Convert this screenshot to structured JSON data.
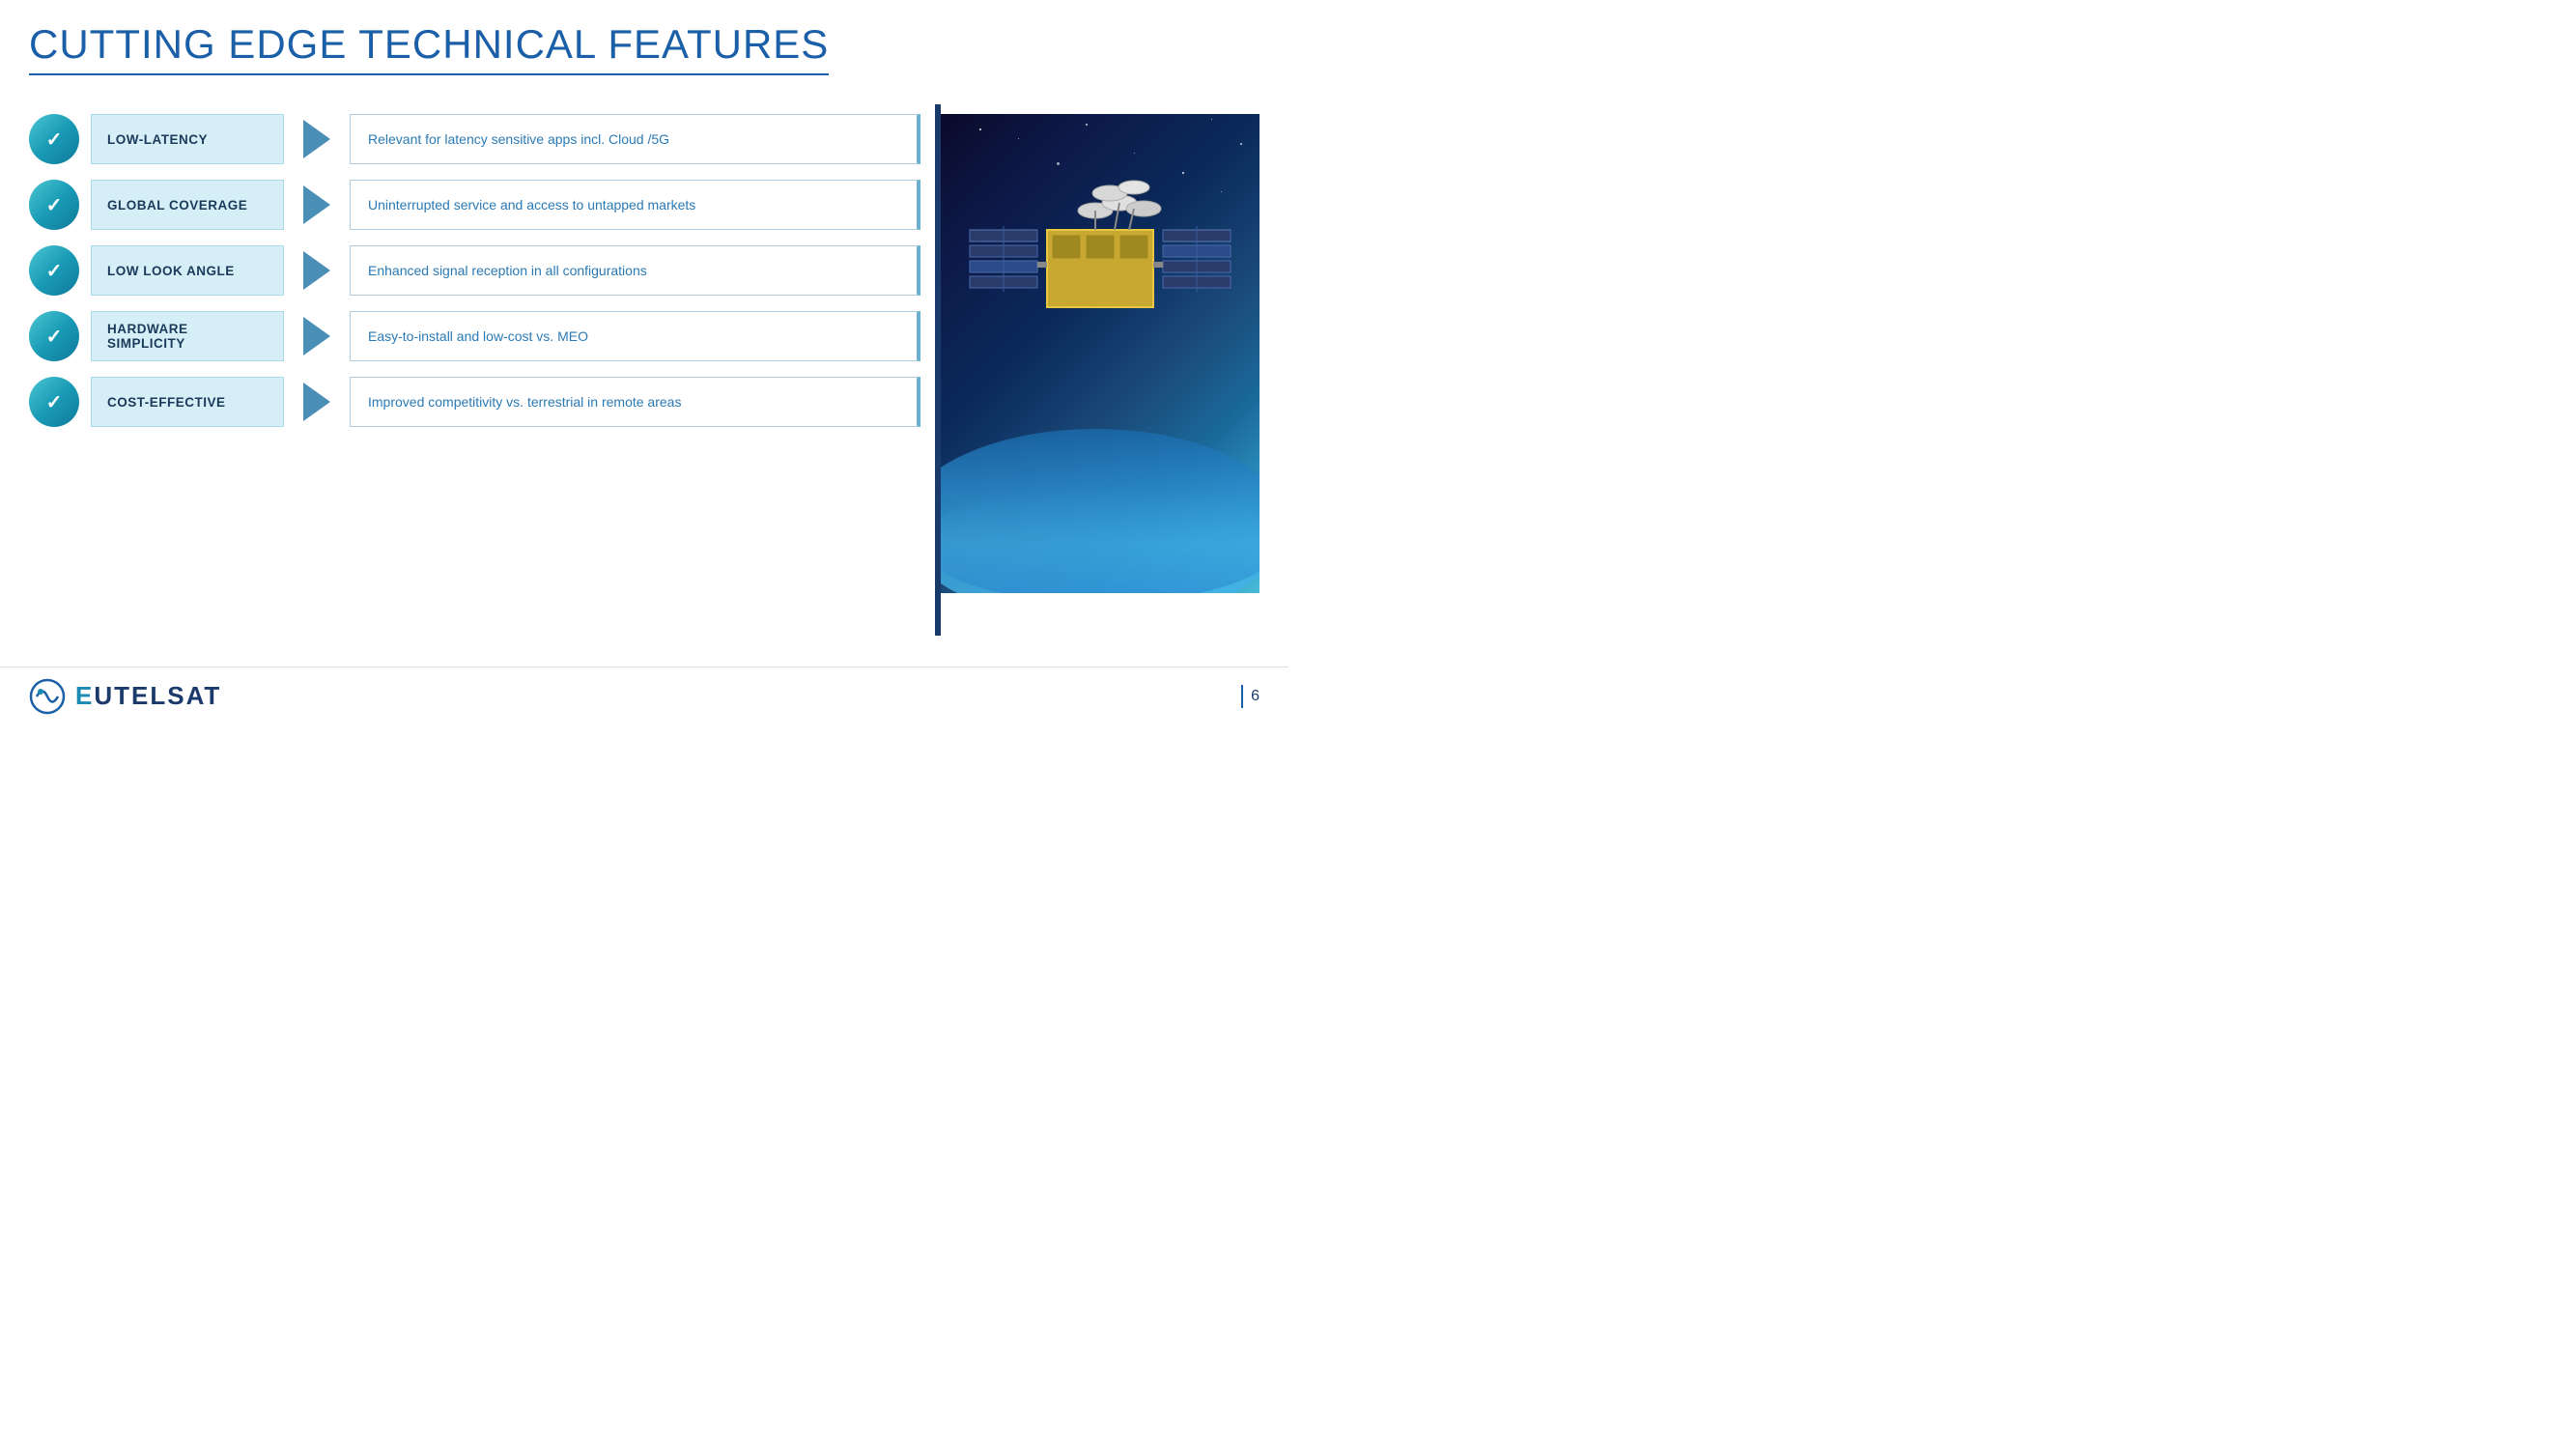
{
  "header": {
    "title": "CUTTING EDGE TECHNICAL FEATURES"
  },
  "features": [
    {
      "id": "low-latency",
      "label": "LOW-LATENCY",
      "description": "Relevant for latency sensitive apps incl. Cloud /5G"
    },
    {
      "id": "global-coverage",
      "label": "GLOBAL COVERAGE",
      "description": "Uninterrupted service and access to untapped markets"
    },
    {
      "id": "low-look-angle",
      "label": "LOW LOOK ANGLE",
      "description": "Enhanced signal reception in all configurations"
    },
    {
      "id": "hardware-simplicity",
      "label": "HARDWARE SIMPLICITY",
      "description": "Easy-to-install and low-cost vs. MEO"
    },
    {
      "id": "cost-effective",
      "label": "COST-EFFECTIVE",
      "description": "Improved competitivity vs. terrestrial in remote areas"
    }
  ],
  "footer": {
    "logo_text_1": "e",
    "logo_text_2": "utelsat",
    "page_number": "6"
  }
}
